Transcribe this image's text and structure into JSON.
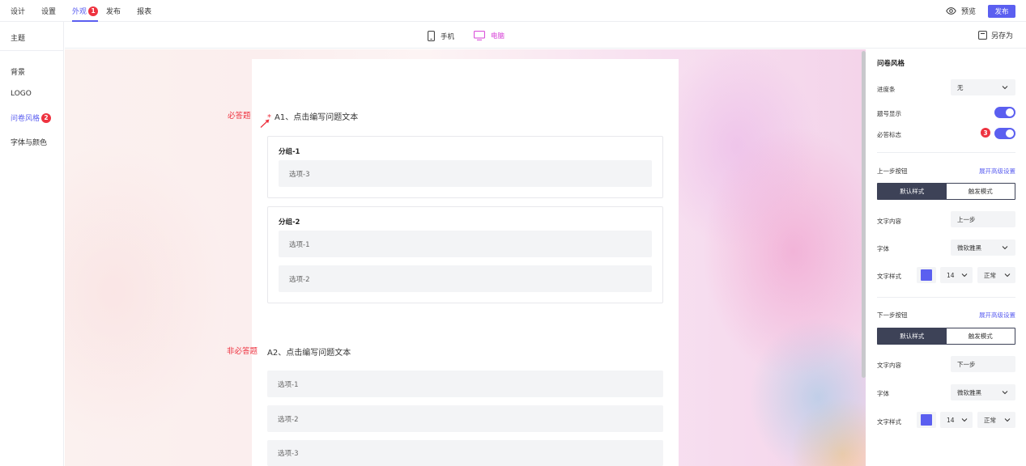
{
  "topnav": {
    "items": [
      "设计",
      "设置",
      "外观",
      "发布",
      "报表"
    ],
    "active_index": 2,
    "badge": "1",
    "preview": "预览",
    "publish": "发布"
  },
  "sidebar": {
    "title": "主题",
    "items": [
      "背景",
      "LOGO",
      "问卷风格",
      "字体与颜色"
    ],
    "active_index": 2,
    "badge": "2"
  },
  "subhead": {
    "devices": [
      "手机",
      "电脑"
    ],
    "active_device": "电脑",
    "save_as": "另存为"
  },
  "annotations": {
    "required": "必答题",
    "optional": "非必答题"
  },
  "questions": [
    {
      "star": "*",
      "title": "A1、点击编写问题文本",
      "groups": [
        {
          "title": "分组-1",
          "options": [
            "选项-3"
          ]
        },
        {
          "title": "分组-2",
          "options": [
            "选项-1",
            "选项-2"
          ]
        }
      ]
    },
    {
      "title": "A2、点击编写问题文本",
      "options": [
        "选项-1",
        "选项-2",
        "选项-3"
      ]
    }
  ],
  "panel": {
    "title": "问卷风格",
    "progress_label": "进度条",
    "progress_value": "无",
    "number_label": "题号显示",
    "number_on": true,
    "required_mark_label": "必答标志",
    "required_mark_on": true,
    "required_badge": "3",
    "prev": {
      "heading": "上一步按钮",
      "advanced": "展开高级设置",
      "tabs": [
        "默认样式",
        "触发模式"
      ],
      "text_label": "文字内容",
      "text_value": "上一步",
      "font_label": "字体",
      "font_value": "微软雅黑",
      "style_label": "文字样式",
      "size_value": "14",
      "weight_value": "正常"
    },
    "next": {
      "heading": "下一步按钮",
      "advanced": "展开高级设置",
      "tabs": [
        "默认样式",
        "触发模式"
      ],
      "text_label": "文字内容",
      "text_value": "下一步",
      "font_label": "字体",
      "font_value": "微软雅黑",
      "style_label": "文字样式",
      "size_value": "14",
      "weight_value": "正常"
    },
    "text_color": "#5b5ff0"
  }
}
